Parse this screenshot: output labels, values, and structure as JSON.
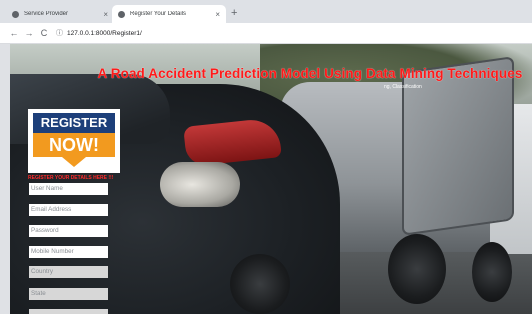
{
  "browser": {
    "tabs": [
      {
        "title": "Service Provider",
        "active": false
      },
      {
        "title": "Register Your Details",
        "active": true
      }
    ],
    "close_glyph": "×",
    "new_tab_glyph": "+",
    "nav": {
      "back": "←",
      "forward": "→",
      "reload": "C",
      "info": "ⓘ"
    },
    "url": "127.0.0.1:8000/Register1/"
  },
  "page": {
    "title": "A Road Accident Prediction Model Using Data Mining Techniques",
    "subtitle": "ng, Classification",
    "badge": {
      "line1": "REGISTER",
      "line2": "NOW!"
    },
    "form_heading": "REGISTER YOUR DETAILS HERE !!!",
    "fields": [
      {
        "placeholder": "User Name"
      },
      {
        "placeholder": "Email Address"
      },
      {
        "placeholder": "Password"
      },
      {
        "placeholder": "Mobile Number"
      },
      {
        "placeholder": "Country"
      },
      {
        "placeholder": "State"
      }
    ]
  },
  "colors": {
    "title": "#ff1a1a",
    "badge_top": "#1d3f7a",
    "badge_bottom": "#f29a1f",
    "form_heading": "#ff2a2a"
  },
  "icons": [
    "favicon-icon",
    "close-icon",
    "new-tab-icon",
    "back-icon",
    "forward-icon",
    "reload-icon",
    "info-icon"
  ]
}
